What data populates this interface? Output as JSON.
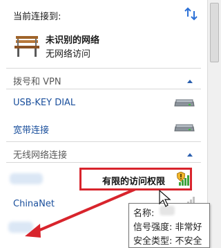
{
  "header": {
    "title": "当前连接到:",
    "refresh_icon": "refresh-arrows-icon"
  },
  "current_network": {
    "name": "未识别的网络",
    "status": "无网络访问",
    "icon": "park-bench-icon"
  },
  "dialup_section": {
    "label": "拨号和 VPN",
    "items": [
      {
        "name": "USB-KEY DIAL",
        "icon": "modem-icon"
      },
      {
        "name": "宽带连接",
        "icon": "modem-icon"
      }
    ]
  },
  "wireless_section": {
    "label": "无线网络连接",
    "highlighted": {
      "status": "有限的访问权限",
      "icon": "shield-warning-icon"
    },
    "items": [
      {
        "name": "ChinaNet"
      }
    ]
  },
  "tooltip": {
    "name_label": "名称:",
    "signal": "信号强度: 非常好",
    "security": "安全类型: 不安全"
  },
  "colors": {
    "link": "#1a4f9c",
    "highlight_border": "#d8242c",
    "signal_green": "#3ca33c"
  }
}
